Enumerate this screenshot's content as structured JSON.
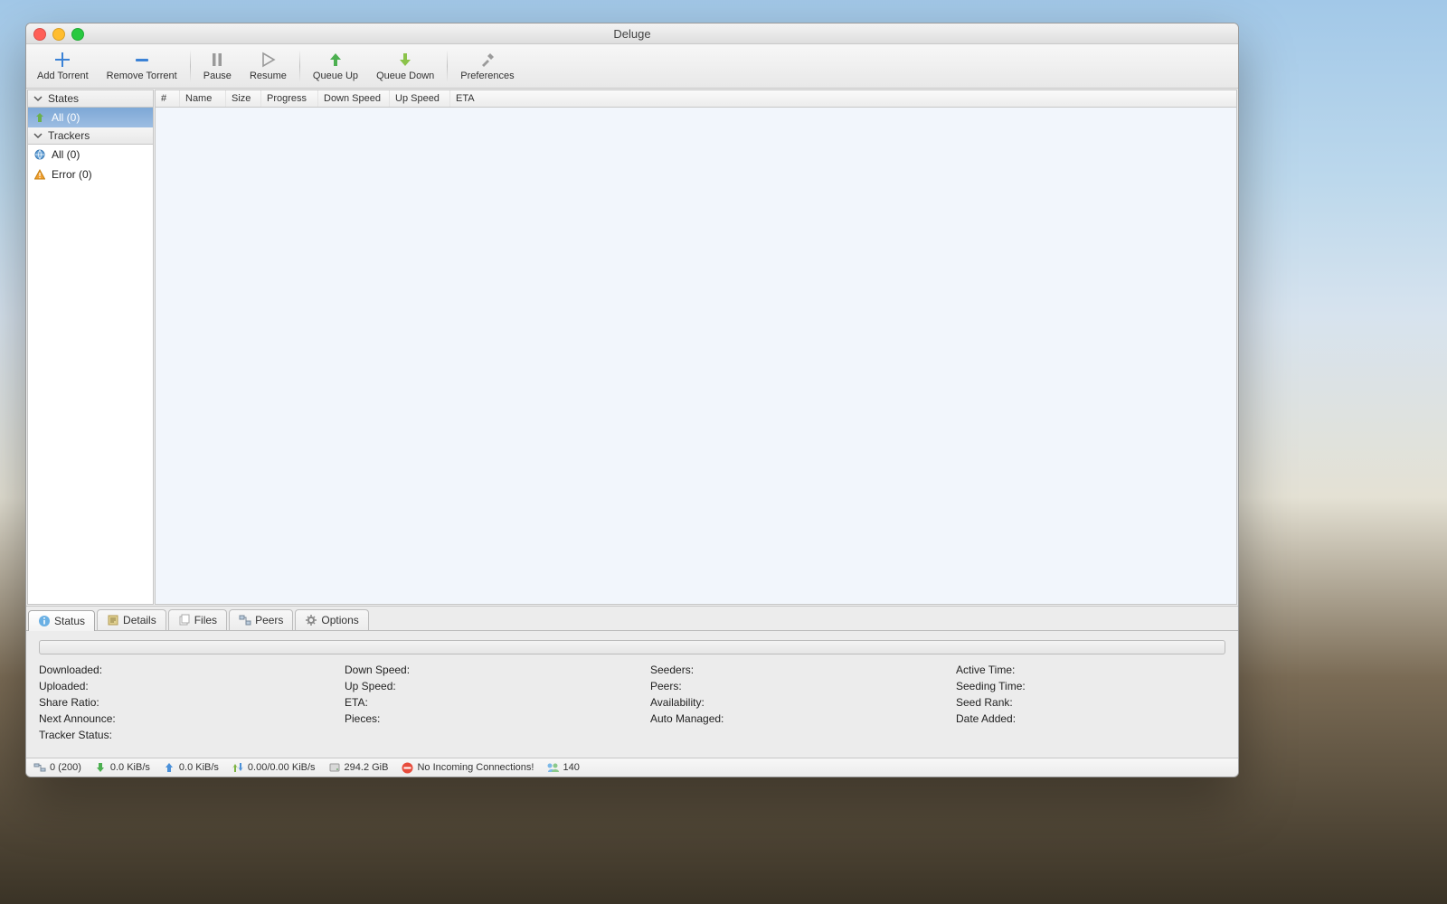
{
  "window": {
    "title": "Deluge"
  },
  "toolbar": {
    "add": "Add Torrent",
    "remove": "Remove Torrent",
    "pause": "Pause",
    "resume": "Resume",
    "queue_up": "Queue Up",
    "queue_down": "Queue Down",
    "preferences": "Preferences"
  },
  "sidebar": {
    "states_label": "States",
    "trackers_label": "Trackers",
    "states": {
      "all": "All (0)"
    },
    "trackers": {
      "all": "All (0)",
      "error": "Error (0)"
    }
  },
  "columns": {
    "num": "#",
    "name": "Name",
    "size": "Size",
    "progress": "Progress",
    "down": "Down Speed",
    "up": "Up Speed",
    "eta": "ETA"
  },
  "tabs": {
    "status": "Status",
    "details": "Details",
    "files": "Files",
    "peers": "Peers",
    "options": "Options"
  },
  "status_panel": {
    "downloaded": "Downloaded:",
    "uploaded": "Uploaded:",
    "share_ratio": "Share Ratio:",
    "next_announce": "Next Announce:",
    "tracker_status": "Tracker Status:",
    "down_speed": "Down Speed:",
    "up_speed": "Up Speed:",
    "eta": "ETA:",
    "pieces": "Pieces:",
    "seeders": "Seeders:",
    "peers": "Peers:",
    "availability": "Availability:",
    "auto_managed": "Auto Managed:",
    "active_time": "Active Time:",
    "seeding_time": "Seeding Time:",
    "seed_rank": "Seed Rank:",
    "date_added": "Date Added:"
  },
  "statusbar": {
    "connections": "0 (200)",
    "down": "0.0 KiB/s",
    "up": "0.0 KiB/s",
    "protocol": "0.00/0.00 KiB/s",
    "disk": "294.2 GiB",
    "health": "No Incoming Connections!",
    "dht": "140"
  }
}
